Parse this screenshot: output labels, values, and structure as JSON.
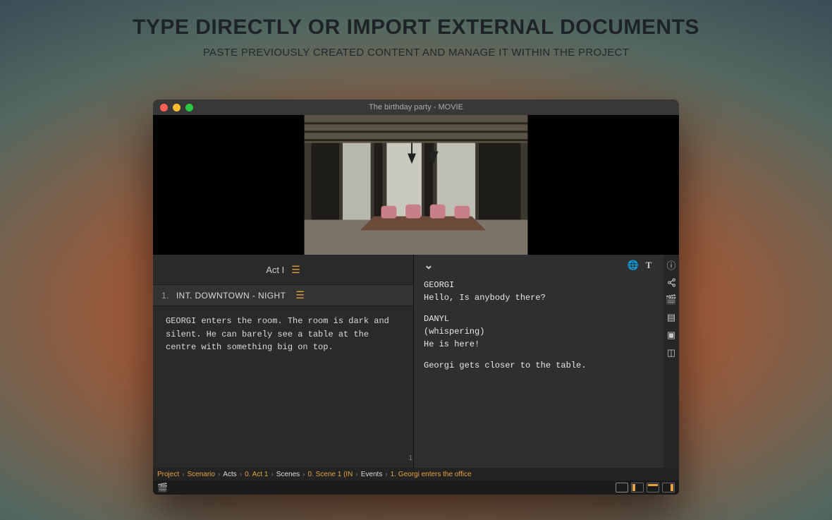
{
  "promo": {
    "headline": "TYPE DIRECTLY OR IMPORT EXTERNAL DOCUMENTS",
    "subline": "PASTE PREVIOUSLY CREATED CONTENT AND MANAGE IT WITHIN THE PROJECT"
  },
  "window": {
    "title": "The birthday party - MOVIE"
  },
  "left": {
    "act_label": "Act I",
    "scene_number": "1.",
    "scene_heading": "INT.  DOWNTOWN - NIGHT",
    "scene_body": "GEORGI enters the room. The room is dark and silent. He can barely see a table at the centre with something big on top.",
    "page_num": "1"
  },
  "right": {
    "char1": "GEORGI",
    "line1": "Hello, Is anybody there?",
    "char2": "DANYL",
    "paren2": "(whispering)",
    "line2": "He is here!",
    "action": "Georgi gets closer to the table.",
    "top_icon_globe": "🌐",
    "top_icon_text": "T"
  },
  "breadcrumb": {
    "b1": "Project",
    "b2": "Scenario",
    "b3": "Acts",
    "b4": "0. Act 1",
    "b5": "Scenes",
    "b6": "0. Scene 1 (IN",
    "b7": "Events",
    "b8": "1. Georgi enters the office"
  },
  "icons": {
    "list": "☰",
    "chevron": "⌄",
    "info": "ⓘ",
    "share": "⋔",
    "clap": "🎬",
    "page": "▤",
    "image": "▣",
    "board": "◫"
  }
}
